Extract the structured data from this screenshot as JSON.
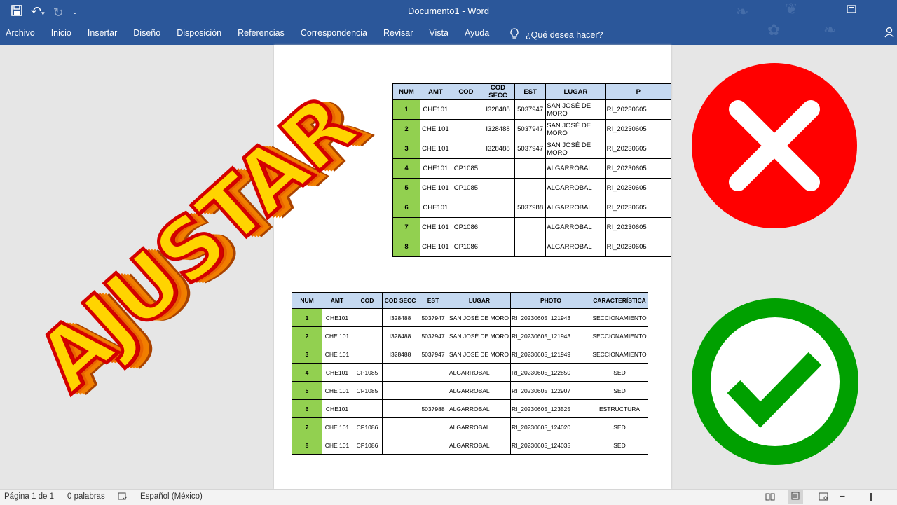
{
  "titlebar": {
    "document_title": "Documento1  -  Word",
    "qat": {
      "save_icon": "save-icon",
      "undo_icon": "undo-icon",
      "redo_icon": "redo-icon",
      "customize_icon": "customize-qat-icon"
    },
    "window_controls": [
      "ribbon-display-icon",
      "minimize-icon"
    ]
  },
  "ribbon_tabs": [
    "Archivo",
    "Inicio",
    "Insertar",
    "Diseño",
    "Disposición",
    "Referencias",
    "Correspondencia",
    "Revisar",
    "Vista",
    "Ayuda"
  ],
  "tell_me": {
    "icon": "lightbulb-icon",
    "label": "¿Qué desea hacer?"
  },
  "overlay_text": "AJUSTAR",
  "table_top": {
    "headers": [
      "NUM",
      "AMT",
      "COD",
      "COD SECC",
      "EST",
      "LUGAR",
      "P"
    ],
    "rows": [
      [
        "1",
        "CHE101",
        "",
        "I328488",
        "5037947",
        "SAN JOSÉ DE MORO",
        "RI_20230605"
      ],
      [
        "2",
        "CHE 101",
        "",
        "I328488",
        "5037947",
        "SAN JOSÉ DE MORO",
        "RI_20230605"
      ],
      [
        "3",
        "CHE 101",
        "",
        "I328488",
        "5037947",
        "SAN JOSÉ DE MORO",
        "RI_20230605"
      ],
      [
        "4",
        "CHE101",
        "CP1085",
        "",
        "",
        "ALGARROBAL",
        "RI_20230605"
      ],
      [
        "5",
        "CHE 101",
        "CP1085",
        "",
        "",
        "ALGARROBAL",
        "RI_20230605"
      ],
      [
        "6",
        "CHE101",
        "",
        "",
        "5037988",
        "ALGARROBAL",
        "RI_20230605"
      ],
      [
        "7",
        "CHE 101",
        "CP1086",
        "",
        "",
        "ALGARROBAL",
        "RI_20230605"
      ],
      [
        "8",
        "CHE 101",
        "CP1086",
        "",
        "",
        "ALGARROBAL",
        "RI_20230605"
      ]
    ]
  },
  "table_bottom": {
    "headers": [
      "NUM",
      "AMT",
      "COD",
      "COD SECC",
      "EST",
      "LUGAR",
      "PHOTO",
      "CARACTERÍSTICA"
    ],
    "rows": [
      [
        "1",
        "CHE101",
        "",
        "I328488",
        "5037947",
        "SAN JOSÉ DE MORO",
        "RI_20230605_121943",
        "SECCIONAMIENTO"
      ],
      [
        "2",
        "CHE 101",
        "",
        "I328488",
        "5037947",
        "SAN JOSÉ DE MORO",
        "RI_20230605_121943",
        "SECCIONAMIENTO"
      ],
      [
        "3",
        "CHE 101",
        "",
        "I328488",
        "5037947",
        "SAN JOSÉ DE MORO",
        "RI_20230605_121949",
        "SECCIONAMIENTO"
      ],
      [
        "4",
        "CHE101",
        "CP1085",
        "",
        "",
        "ALGARROBAL",
        "RI_20230605_122850",
        "SED"
      ],
      [
        "5",
        "CHE 101",
        "CP1085",
        "",
        "",
        "ALGARROBAL",
        "RI_20230605_122907",
        "SED"
      ],
      [
        "6",
        "CHE101",
        "",
        "",
        "5037988",
        "ALGARROBAL",
        "RI_20230605_123525",
        "ESTRUCTURA"
      ],
      [
        "7",
        "CHE 101",
        "CP1086",
        "",
        "",
        "ALGARROBAL",
        "RI_20230605_124020",
        "SED"
      ],
      [
        "8",
        "CHE 101",
        "CP1086",
        "",
        "",
        "ALGARROBAL",
        "RI_20230605_124035",
        "SED"
      ]
    ]
  },
  "badges": {
    "wrong": {
      "icon": "x-mark-icon",
      "color": "#ff0000"
    },
    "right": {
      "icon": "check-mark-icon",
      "color": "#00a000"
    }
  },
  "statusbar": {
    "page": "Página 1 de 1",
    "words": "0 palabras",
    "language": "Español (México)",
    "view_icons": [
      "read-mode-icon",
      "print-layout-icon",
      "web-layout-icon"
    ],
    "zoom_out": "−"
  },
  "colors": {
    "ribbon": "#2b579a",
    "header_fill": "#c5d9f1",
    "num_fill": "#92d050",
    "ajustar_fill": "#ffd400",
    "ajustar_stroke": "#d40000"
  }
}
